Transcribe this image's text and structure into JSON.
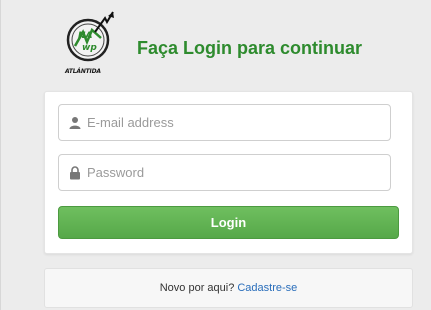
{
  "header": {
    "title": "Faça Login para continuar",
    "logo_caption": "ATLÁNTIDA"
  },
  "form": {
    "email": {
      "placeholder": "E-mail address",
      "value": ""
    },
    "password": {
      "placeholder": "Password",
      "value": ""
    },
    "login_label": "Login"
  },
  "signup": {
    "prompt": "Novo por aqui?",
    "link_label": "Cadastre-se"
  },
  "colors": {
    "title": "#2e8b2e",
    "button": "#5cb85c",
    "link": "#2a6ebb"
  }
}
